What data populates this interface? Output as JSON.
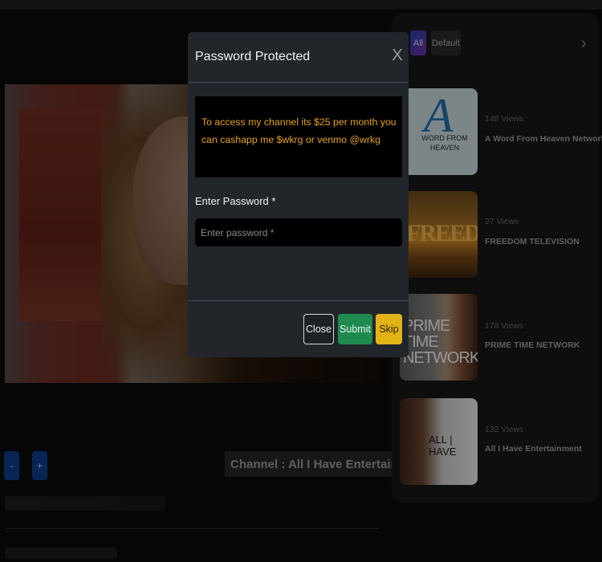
{
  "player": {
    "minus_label": "-",
    "plus_label": "+",
    "channel_label": "Channel : All I Have Entertainment"
  },
  "sidebar": {
    "filters": [
      "All",
      "Default"
    ],
    "next_icon": "chevron-right-icon",
    "cards": [
      {
        "views": "148 Views",
        "title": "A Word From Heaven Network",
        "thumb_text": "A",
        "thumb_sub": "WORD FROM HEAVEN"
      },
      {
        "views": "27 Views",
        "title": "FREEDOM TELEVISION",
        "thumb_text": "FREEDOM"
      },
      {
        "views": "178 Views",
        "title": "PRIME TIME NETWORK",
        "thumb_text": "PRIME TIME NETWORK"
      },
      {
        "views": "132 Views",
        "title": "All I Have Entertainment",
        "thumb_text": "ALL | HAVE"
      }
    ]
  },
  "modal": {
    "title": "Password Protected",
    "close_icon": "close-icon",
    "close_glyph": "X",
    "message": "To access my channel its $25 per month you can cashapp me $wkrg or venmo @wrkg",
    "password_label": "Enter Password *",
    "password_placeholder": "Enter password *",
    "password_value": "",
    "buttons": {
      "close": "Close",
      "submit": "Submit",
      "skip": "Skip"
    }
  },
  "colors": {
    "notice_text": "#e5a21a",
    "submit": "#1f8a4e",
    "skip": "#e2b316",
    "filter_all": "#4b37a8"
  }
}
